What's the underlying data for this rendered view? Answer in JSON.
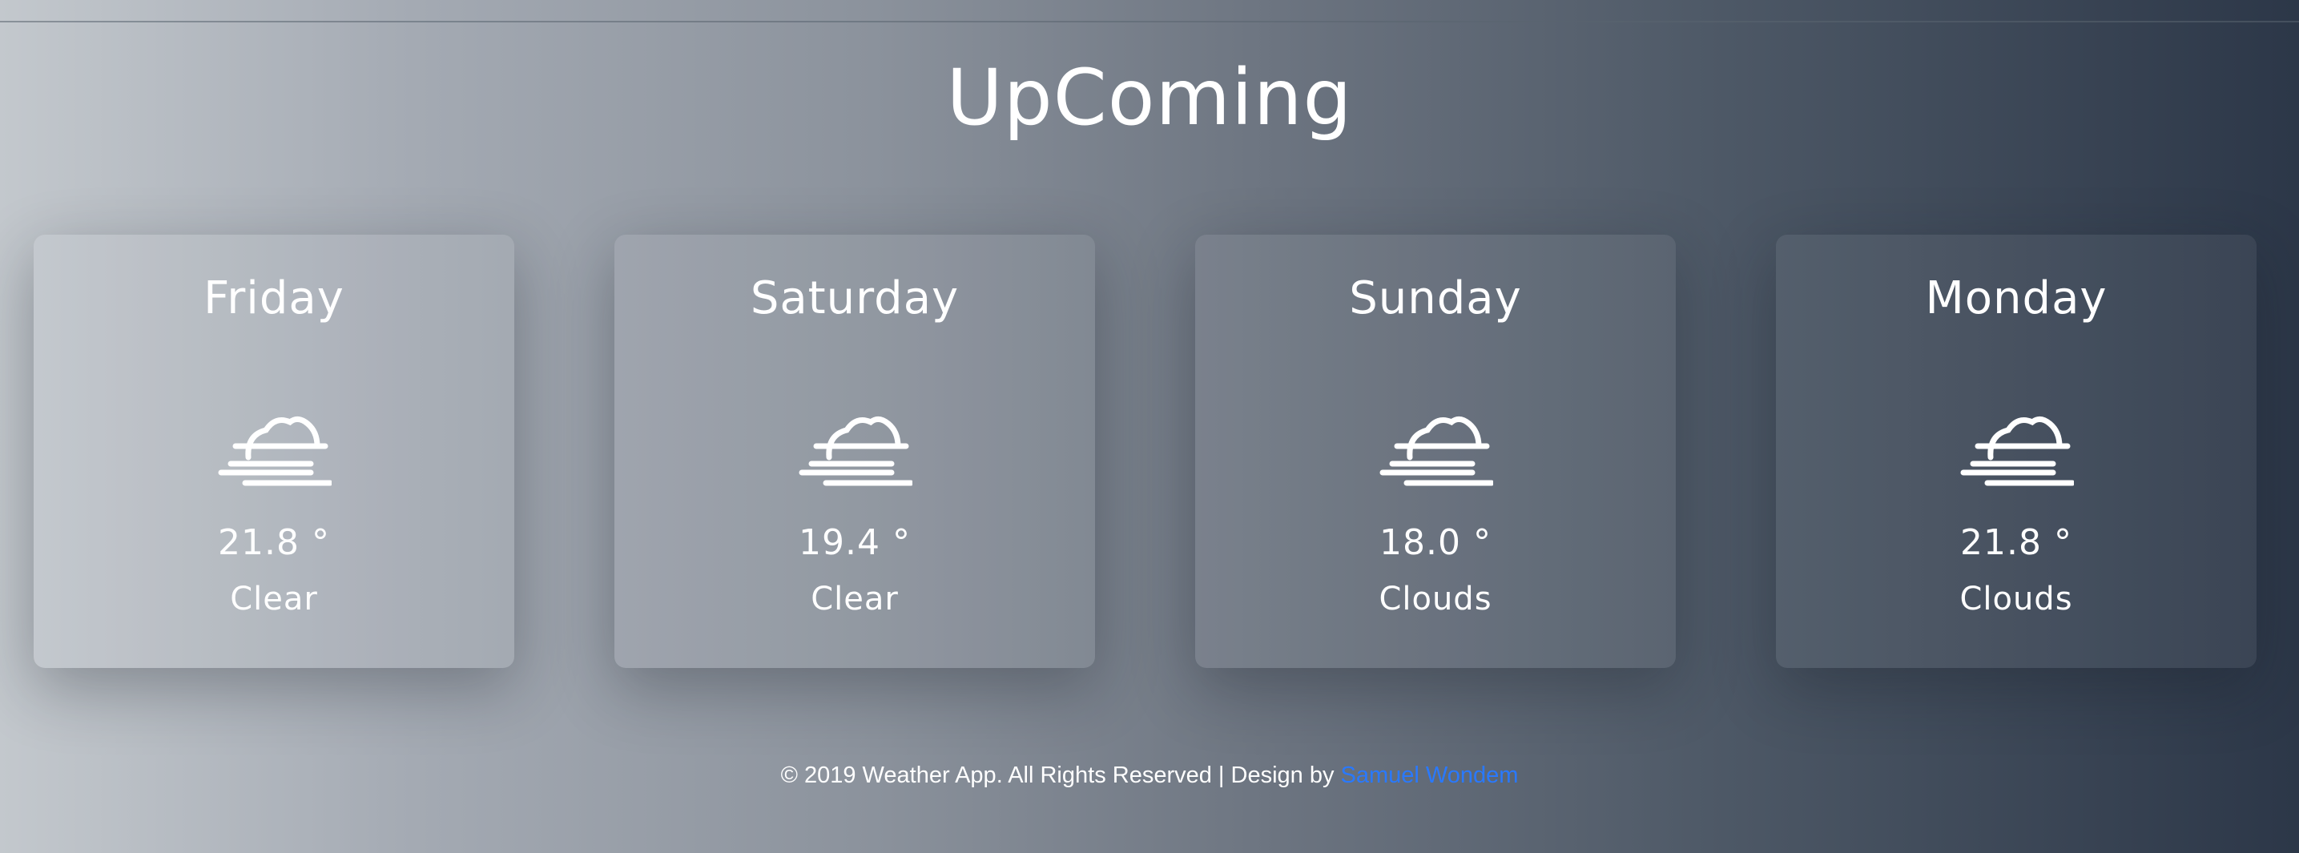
{
  "page": {
    "title": "UpComing"
  },
  "forecast": [
    {
      "day": "Friday",
      "temp": "21.8 °",
      "description": "Clear",
      "icon": "fog-icon"
    },
    {
      "day": "Saturday",
      "temp": "19.4 °",
      "description": "Clear",
      "icon": "fog-icon"
    },
    {
      "day": "Sunday",
      "temp": "18.0 °",
      "description": "Clouds",
      "icon": "fog-icon"
    },
    {
      "day": "Monday",
      "temp": "21.8 °",
      "description": "Clouds",
      "icon": "fog-icon"
    }
  ],
  "footer": {
    "text": "© 2019 Weather App. All Rights Reserved | Design by ",
    "link_text": "Samuel Wondem",
    "link_color": "#2979ff"
  },
  "colors": {
    "background_light": "#c3c8cd",
    "background_dark": "#2c3748",
    "text": "#ffffff"
  }
}
